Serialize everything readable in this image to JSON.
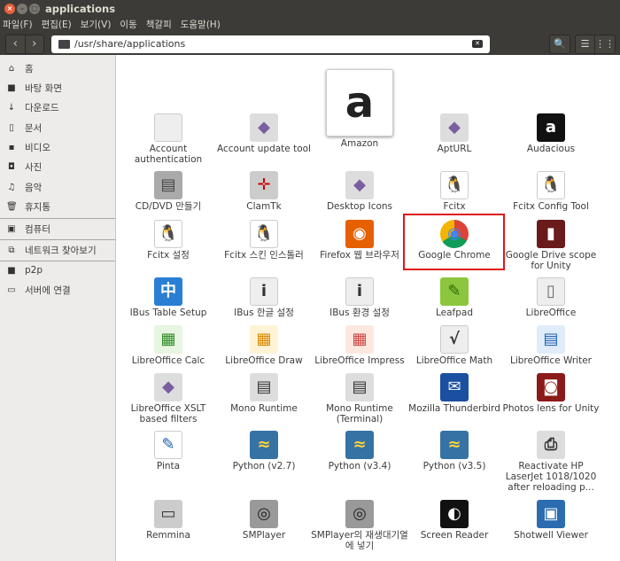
{
  "window": {
    "title": "applications"
  },
  "menu": [
    "파일(F)",
    "편집(E)",
    "보기(V)",
    "이동",
    "책갈피",
    "도움말(H)"
  ],
  "toolbar": {
    "path": "/usr/share/applications",
    "back": "‹",
    "forward": "›",
    "search": "🔍",
    "list_view": "☰",
    "grid_view": "⋮⋮"
  },
  "sidebar": [
    "홈",
    "바탕 화면",
    "다운로드",
    "문서",
    "비디오",
    "사진",
    "음악",
    "휴지통",
    "컴퓨터",
    "네트워크 찾아보기",
    "p2p",
    "서버에 연결"
  ],
  "apps": [
    [
      "Account authentication",
      "Account update tool",
      "Amazon",
      "AptURL",
      "Audacious"
    ],
    [
      "CD/DVD 만들기",
      "ClamTk",
      "Desktop Icons",
      "Fcitx",
      "Fcitx Config Tool"
    ],
    [
      "Fcitx 설정",
      "Fcitx 스킨 인스톨러",
      "Firefox 웹 브라우저",
      "Google Chrome",
      "Google Drive scope for Unity"
    ],
    [
      "IBus Table Setup",
      "IBus 한글 설정",
      "IBus 환경 설정",
      "Leafpad",
      "LibreOffice"
    ],
    [
      "LibreOffice Calc",
      "LibreOffice Draw",
      "LibreOffice Impress",
      "LibreOffice Math",
      "LibreOffice Writer"
    ],
    [
      "LibreOffice XSLT based filters",
      "Mono Runtime",
      "Mono Runtime (Terminal)",
      "Mozilla Thunderbird",
      "Photos lens for Unity"
    ],
    [
      "Pinta",
      "Python (v2.7)",
      "Python (v3.4)",
      "Python (v3.5)",
      "Reactivate HP LaserJet 1018/1020 after reloading p..."
    ],
    [
      "Remmina",
      "SMPlayer",
      "SMPlayer의 재생대기열에 넣기",
      "Screen Reader",
      "Shotwell Viewer"
    ]
  ],
  "selected_app": "Google Chrome"
}
